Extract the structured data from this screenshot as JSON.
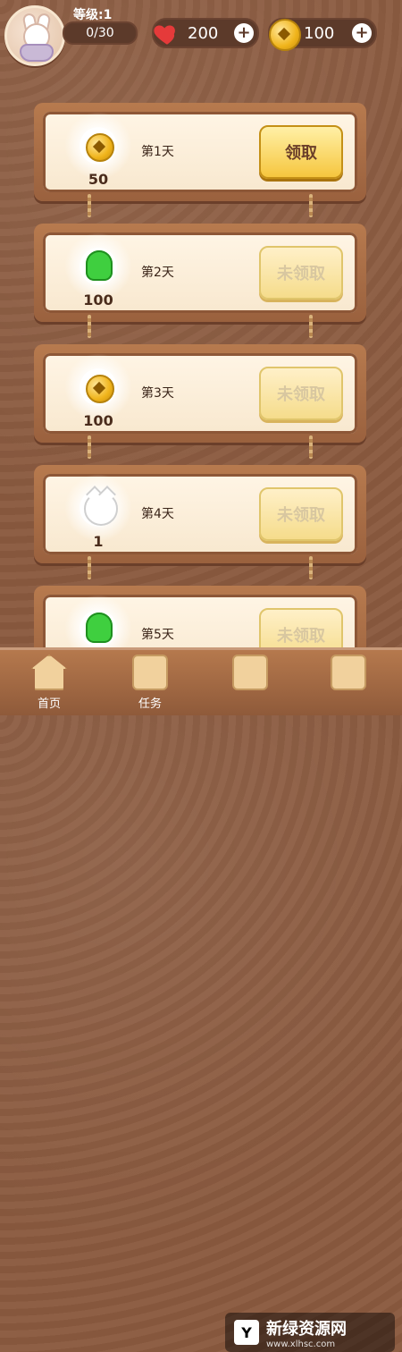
{
  "header": {
    "level": "等级:1",
    "progress_text": "0/30",
    "hearts": "200",
    "coins": "100"
  },
  "rewards": [
    {
      "day": "第1天",
      "amount": "50",
      "type": "coin",
      "button": "领取",
      "state": "active"
    },
    {
      "day": "第2天",
      "amount": "100",
      "type": "green-head",
      "button": "未领取",
      "state": "disabled"
    },
    {
      "day": "第3天",
      "amount": "100",
      "type": "coin",
      "button": "未领取",
      "state": "disabled"
    },
    {
      "day": "第4天",
      "amount": "1",
      "type": "cat",
      "button": "未领取",
      "state": "disabled"
    },
    {
      "day": "第5天",
      "amount": "",
      "type": "green-head",
      "button": "未领取",
      "state": "disabled"
    }
  ],
  "bottom_nav": [
    {
      "label": "首页",
      "icon": "home-icon"
    },
    {
      "label": "任务",
      "icon": "tasks-icon"
    },
    {
      "label": "",
      "icon": "store-icon"
    },
    {
      "label": "",
      "icon": "calendar-icon"
    }
  ],
  "watermark": {
    "title": "新绿资源网",
    "url": "www.xlhsc.com"
  },
  "colors": {
    "background": "#8a5a3f",
    "card_frame": "#b77a4e",
    "active_button": "#f6c63e",
    "disabled_button": "#f5dc8b"
  }
}
